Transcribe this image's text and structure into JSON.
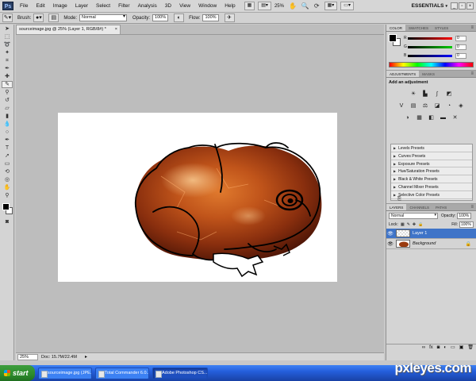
{
  "menubar": {
    "app_logo": "Ps",
    "items": [
      "File",
      "Edit",
      "Image",
      "Layer",
      "Select",
      "Filter",
      "Analysis",
      "3D",
      "View",
      "Window",
      "Help"
    ],
    "zoom": "25%",
    "workspace": "ESSENTIALS"
  },
  "options": {
    "brush_label": "Brush:",
    "mode_label": "Mode:",
    "mode_value": "Normal",
    "opacity_label": "Opacity:",
    "opacity_value": "100%",
    "flow_label": "Flow:",
    "flow_value": "100%"
  },
  "document": {
    "tab_title": "sourceimage.jpg @ 25% (Layer 1, RGB/8#) *",
    "close": "×",
    "status_zoom": "25%",
    "status_doc": "Doc: 15.7M/22.4M"
  },
  "color_panel": {
    "tabs": [
      "COLOR",
      "SWATCHES",
      "STYLES"
    ],
    "channels": [
      {
        "label": "R",
        "value": "0",
        "color": "#ff0000"
      },
      {
        "label": "G",
        "value": "0",
        "color": "#00cc00"
      },
      {
        "label": "B",
        "value": "0",
        "color": "#0000ff"
      }
    ]
  },
  "adjustments_panel": {
    "tabs": [
      "ADJUSTMENTS",
      "MASKS"
    ],
    "title": "Add an adjustment",
    "presets": [
      "Levels Presets",
      "Curves Presets",
      "Exposure Presets",
      "Hue/Saturation Presets",
      "Black & White Presets",
      "Channel Mixer Presets",
      "Selective Color Presets"
    ]
  },
  "layers_panel": {
    "tabs": [
      "LAYERS",
      "CHANNELS",
      "PATHS"
    ],
    "blend_mode": "Normal",
    "opacity_label": "Opacity:",
    "opacity_value": "100%",
    "lock_label": "Lock:",
    "fill_label": "Fill:",
    "fill_value": "100%",
    "layers": [
      {
        "name": "Layer 1",
        "selected": true
      },
      {
        "name": "Background",
        "selected": false
      }
    ]
  },
  "taskbar": {
    "start": "start",
    "tasks": [
      {
        "label": "sourceimage.jpg (JPE...",
        "active": false
      },
      {
        "label": "Total Commander 6.0...",
        "active": false
      },
      {
        "label": "Adobe Photoshop CS...",
        "active": true
      }
    ]
  },
  "watermark": "pxleyes.com"
}
